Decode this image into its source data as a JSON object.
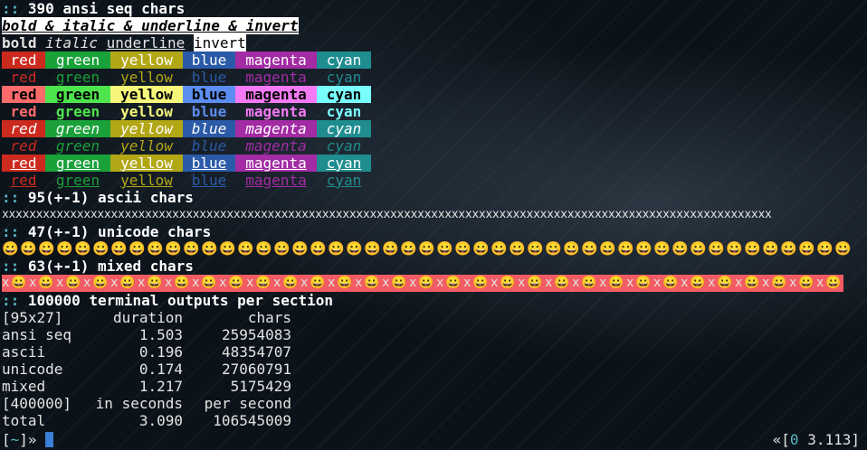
{
  "headers": {
    "ansi": "390 ansi seq chars",
    "ascii": "95(+-1) ascii chars",
    "unicode": "47(+-1) unicode chars",
    "mixed": "63(+-1) mixed chars",
    "outputs": "100000 terminal outputs per section",
    "prefix": "::"
  },
  "styles_line1": "bold & italic & underline & invert",
  "styles_line2": {
    "bold": "bold",
    "italic": "italic",
    "underline": "underline",
    "invert": "invert"
  },
  "color_words": [
    "red",
    "green",
    "yellow",
    "blue",
    "magenta",
    "cyan"
  ],
  "colors": {
    "red": "#cc2a1f",
    "green": "#1aa13a",
    "yellow": "#b2a715",
    "blue": "#2a5aa8",
    "magenta": "#a32ba4",
    "cyan": "#1f8d8f",
    "bright_red": "#ff6b6b",
    "bright_green": "#4ee44e",
    "bright_yellow": "#f6f67a",
    "bright_blue": "#5c8df0",
    "bright_magenta": "#f57af5",
    "bright_cyan": "#7affff",
    "accent": "#56b6c2",
    "mixed_bg": "#f25c64",
    "cursor": "#3b7fd6"
  },
  "ascii_line": "xxxxxxxxxxxxxxxxxxxxxxxxxxxxxxxxxxxxxxxxxxxxxxxxxxxxxxxxxxxxxxxxxxxxxxxxxxxxxxxxxxxxxxxxxxxxxxxxxxxxxxxxxxxxxxxxx",
  "emoji": "😀",
  "mixed_x": "x",
  "stats": {
    "header": [
      "[95x27]",
      "duration",
      "chars"
    ],
    "rows": [
      [
        "ansi seq",
        "1.503",
        "25954083"
      ],
      [
        "ascii",
        "0.196",
        "48354707"
      ],
      [
        "unicode",
        "0.174",
        "27060791"
      ],
      [
        "mixed",
        "1.217",
        "5175429"
      ]
    ],
    "footer_header": [
      "[400000]",
      "in seconds",
      "per second"
    ],
    "total": [
      "total",
      "3.090",
      "106545009"
    ]
  },
  "prompt": {
    "left_open": "[",
    "tilde": "~",
    "left_close": "]»",
    "right_open": "«[",
    "status": "0",
    "time": "3.113",
    "right_close": "]"
  }
}
